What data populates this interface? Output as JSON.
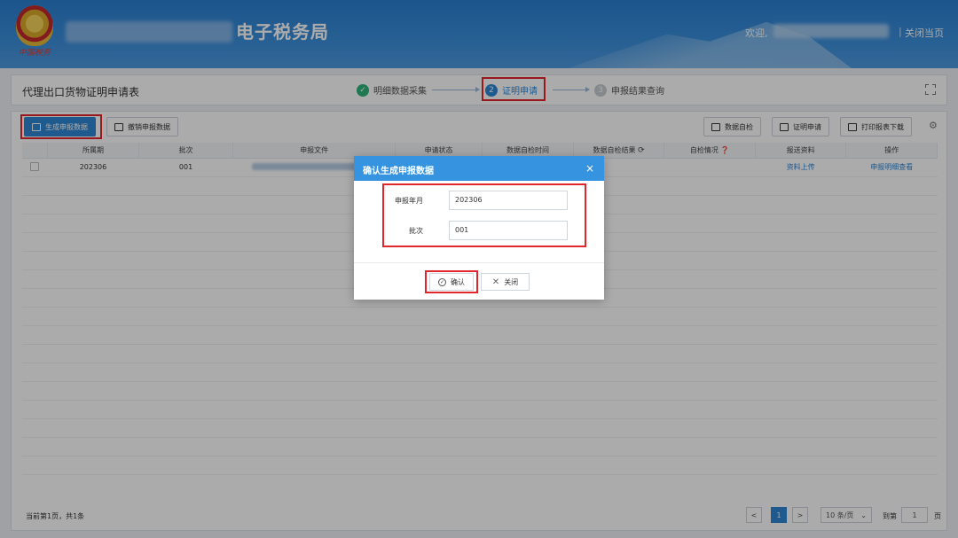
{
  "header": {
    "emblem_text": "中国税务",
    "title": "电子税务局",
    "welcome": "欢迎,",
    "separator": "|",
    "close_page": "关闭当页"
  },
  "toolbar_top": {
    "form_title": "代理出口货物证明申请表",
    "steps": [
      {
        "num": "✓",
        "label": "明细数据采集",
        "state": "done"
      },
      {
        "num": "2",
        "label": "证明申请",
        "state": "active"
      },
      {
        "num": "3",
        "label": "申报结果查询",
        "state": "pending"
      }
    ]
  },
  "actions": {
    "generate": "生成申报数据",
    "revoke": "撤销申报数据",
    "self_check": "数据自检",
    "apply": "证明申请",
    "print": "打印报表下载"
  },
  "table": {
    "headers": [
      "所属期",
      "批次",
      "申报文件",
      "申请状态",
      "数据自检时间",
      "数据自检结果",
      "自检情况",
      "报送资料",
      "操作"
    ],
    "rows": [
      {
        "period": "202306",
        "batch": "001",
        "upload": "资料上传",
        "detail": "申报明细查看"
      }
    ]
  },
  "footer": {
    "count": "当前第1页，共1条",
    "prev": "<",
    "page": "1",
    "next": ">",
    "page_size": "10 条/页",
    "goto_label": "到第",
    "goto_value": "1",
    "page_unit": "页"
  },
  "dialog": {
    "title": "确认生成申报数据",
    "close_x": "×",
    "label_month": "申报年月",
    "value_month": "202306",
    "label_batch": "批次",
    "value_batch": "001",
    "confirm": "确认",
    "close": "关闭"
  },
  "colors": {
    "header_blue": "#2a7fd0",
    "primary": "#2f86d6",
    "success_green": "#2db37a",
    "highlight_red": "#e2262d"
  }
}
